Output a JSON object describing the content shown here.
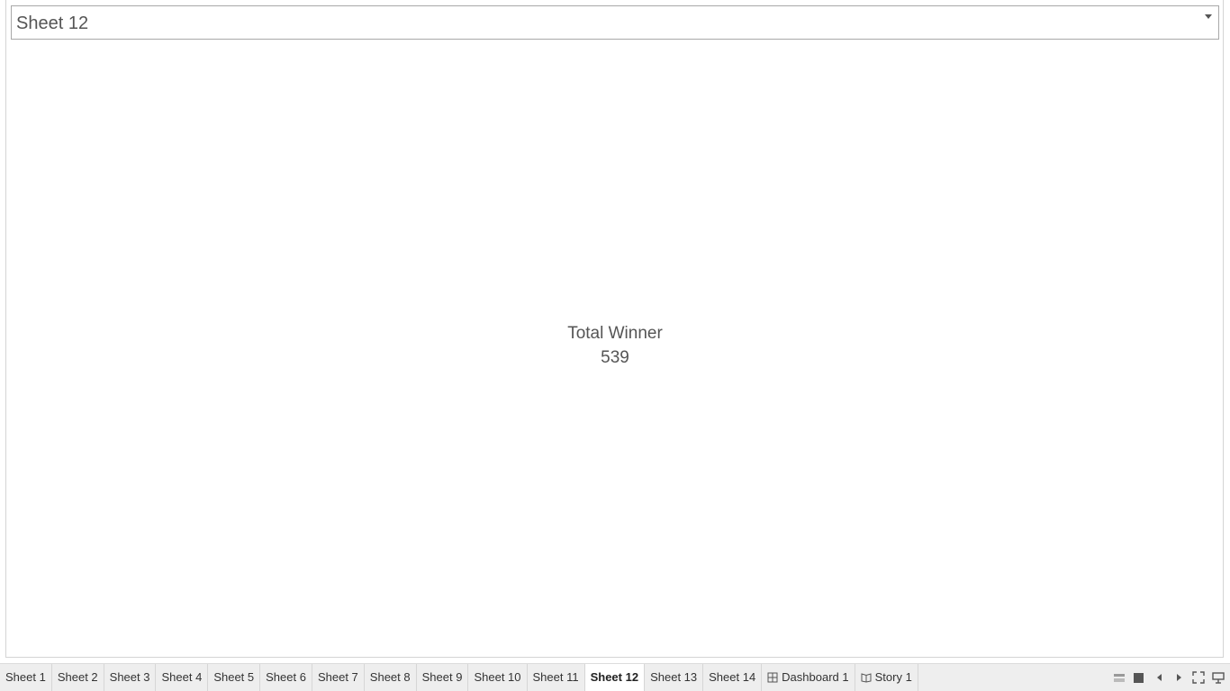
{
  "sheet": {
    "title": "Sheet 12",
    "kpi_label": "Total Winner",
    "kpi_value": "539"
  },
  "tabs": [
    {
      "label": "Sheet 1",
      "active": false,
      "icon": null
    },
    {
      "label": "Sheet 2",
      "active": false,
      "icon": null
    },
    {
      "label": "Sheet 3",
      "active": false,
      "icon": null
    },
    {
      "label": "Sheet 4",
      "active": false,
      "icon": null
    },
    {
      "label": "Sheet 5",
      "active": false,
      "icon": null
    },
    {
      "label": "Sheet 6",
      "active": false,
      "icon": null
    },
    {
      "label": "Sheet 7",
      "active": false,
      "icon": null
    },
    {
      "label": "Sheet 8",
      "active": false,
      "icon": null
    },
    {
      "label": "Sheet 9",
      "active": false,
      "icon": null
    },
    {
      "label": "Sheet 10",
      "active": false,
      "icon": null
    },
    {
      "label": "Sheet 11",
      "active": false,
      "icon": null
    },
    {
      "label": "Sheet 12",
      "active": true,
      "icon": null
    },
    {
      "label": "Sheet 13",
      "active": false,
      "icon": null
    },
    {
      "label": "Sheet 14",
      "active": false,
      "icon": null
    },
    {
      "label": "Dashboard 1",
      "active": false,
      "icon": "dashboard-icon"
    },
    {
      "label": "Story 1",
      "active": false,
      "icon": "story-icon"
    }
  ],
  "controls": [
    {
      "name": "show-filmstrip-icon"
    },
    {
      "name": "show-tabs-icon"
    },
    {
      "name": "previous-sheet-icon"
    },
    {
      "name": "next-sheet-icon"
    },
    {
      "name": "fullscreen-icon"
    },
    {
      "name": "presentation-mode-icon"
    }
  ],
  "colors": {
    "active_tab_bg": "#ffffff",
    "tabbar_bg": "#eeeeee",
    "text": "#555555"
  }
}
